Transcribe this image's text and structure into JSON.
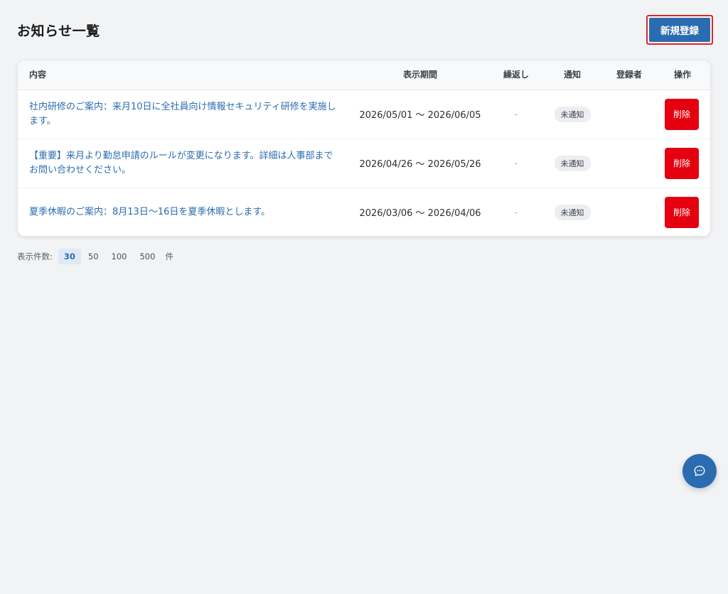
{
  "header": {
    "title": "お知らせ一覧",
    "new_button_label": "新規登録"
  },
  "table": {
    "columns": {
      "content": "内容",
      "period": "表示期間",
      "repeat": "繰返し",
      "notify": "通知",
      "registrant": "登録者",
      "ops": "操作"
    },
    "rows": [
      {
        "content": "社内研修のご案内：来月10日に全社員向け情報セキュリティ研修を実施します。",
        "period": "2026/05/01 〜 2026/06/05",
        "repeat": "-",
        "notify": "未通知",
        "registrant": "",
        "delete_label": "削除"
      },
      {
        "content": "【重要】来月より勤怠申請のルールが変更になります。詳細は人事部までお問い合わせください。",
        "period": "2026/04/26 〜 2026/05/26",
        "repeat": "-",
        "notify": "未通知",
        "registrant": "",
        "delete_label": "削除"
      },
      {
        "content": "夏季休暇のご案内：8月13日〜16日を夏季休暇とします。",
        "period": "2026/03/06 〜 2026/04/06",
        "repeat": "-",
        "notify": "未通知",
        "registrant": "",
        "delete_label": "削除"
      }
    ]
  },
  "pagination": {
    "label": "表示件数:",
    "options": [
      "30",
      "50",
      "100",
      "500"
    ],
    "selected": "30",
    "suffix": "件"
  },
  "chat_fab": {
    "icon": "chat-bubble-icon"
  },
  "colors": {
    "primary": "#2b6cb0",
    "danger": "#e4000f",
    "focus_outline": "#d9262b",
    "background": "#f2f3f5"
  }
}
